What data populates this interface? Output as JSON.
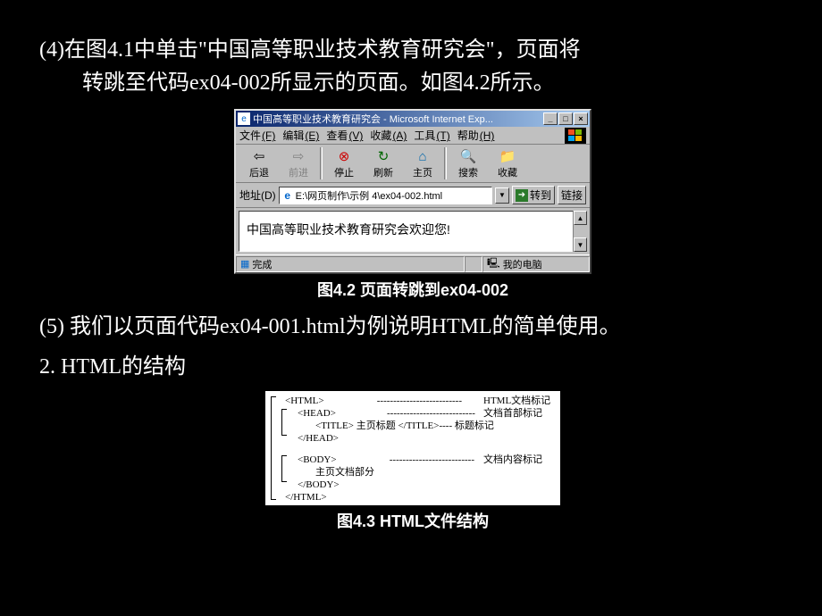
{
  "para4_line1": "(4)在图4.1中单击\"中国高等职业技术教育研究会\"，页面将",
  "para4_line2": "转跳至代码ex04-002所显示的页面。如图4.2所示。",
  "browser": {
    "title": "中国高等职业技术教育研究会 - Microsoft Internet Exp...",
    "menus": {
      "file": "文件",
      "file_k": "(F)",
      "edit": "编辑",
      "edit_k": "(E)",
      "view": "查看",
      "view_k": "(V)",
      "fav": "收藏",
      "fav_k": "(A)",
      "tools": "工具",
      "tools_k": "(T)",
      "help": "帮助",
      "help_k": "(H)"
    },
    "toolbar": {
      "back": "后退",
      "forward": "前进",
      "stop": "停止",
      "refresh": "刷新",
      "home": "主页",
      "search": "搜索",
      "favorites": "收藏"
    },
    "address_label": "地址(D)",
    "address_value": "E:\\网页制作\\示例 4\\ex04-002.html",
    "go_label": "转到",
    "links_label": "链接",
    "page_content": "中国高等职业技术教育研究会欢迎您!",
    "status_done": "完成",
    "status_zone": "我的电脑"
  },
  "caption42": "图4.2  页面转跳到ex04-002",
  "para5": "(5) 我们以页面代码ex04-001.html为例说明HTML的简单使用。",
  "para6": "2. HTML的结构",
  "struct": {
    "r1_tag": "<HTML>",
    "r1_desc": "HTML文档标记",
    "r2_tag": "<HEAD>",
    "r2_desc": "文档首部标记",
    "r3_tag": "<TITLE> 主页标题 </TITLE>",
    "r3_desc": "标题标记",
    "r4_tag": "</HEAD>",
    "r5_tag": "<BODY>",
    "r5_desc": "文档内容标记",
    "r6_tag": "主页文档部分",
    "r7_tag": "</BODY>",
    "r8_tag": "</HTML>"
  },
  "caption43": "图4.3  HTML文件结构"
}
